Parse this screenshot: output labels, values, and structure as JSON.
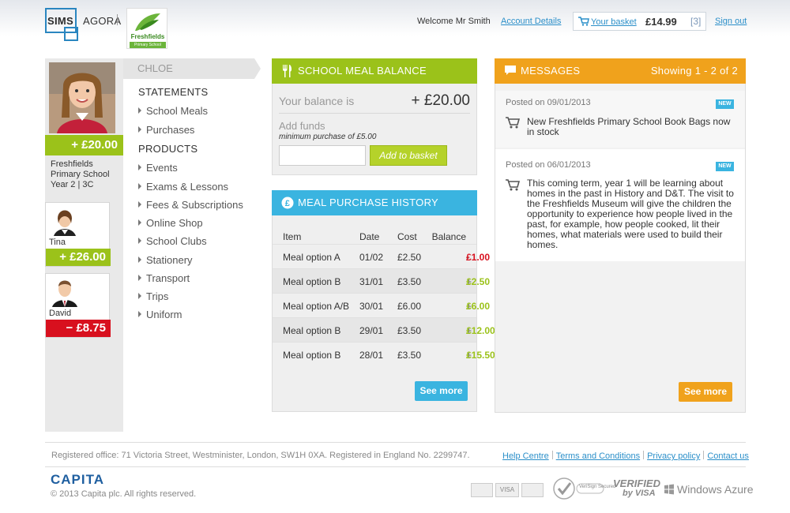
{
  "header": {
    "brand_left": "SIMS",
    "brand_right": "AGORA",
    "school_name": "Freshfields",
    "school_sub": "Primary School",
    "welcome": "Welcome Mr Smith",
    "account_link": "Account Details",
    "basket_label": "Your basket",
    "basket_amount": "£14.99",
    "basket_count": "[3]",
    "signout": "Sign out"
  },
  "profile": {
    "balance": "+ £20.00",
    "school_line1": "Freshfields",
    "school_line2": "Primary School",
    "class_line": "Year 2 | 3C",
    "siblings": [
      {
        "name": "Tina",
        "balance": "+ £26.00",
        "status": "positive"
      },
      {
        "name": "David",
        "balance": "− £8.75",
        "status": "negative"
      }
    ]
  },
  "nav": {
    "child": "CHLOE",
    "statements_heading": "STATEMENTS",
    "statements": [
      "School Meals",
      "Purchases"
    ],
    "products_heading": "PRODUCTS",
    "products": [
      "Events",
      "Exams & Lessons",
      "Fees & Subscriptions",
      "Online Shop",
      "School Clubs",
      "Stationery",
      "Transport",
      "Trips",
      "Uniform"
    ]
  },
  "meal_balance": {
    "title": "SCHOOL MEAL BALANCE",
    "balance_label": "Your balance is",
    "balance_value": "+ £20.00",
    "add_funds_label": "Add funds",
    "minimum_note": "minimum purchase of £5.00",
    "add_button": "Add to basket"
  },
  "history": {
    "title": "MEAL PURCHASE HISTORY",
    "columns": [
      "Item",
      "Date",
      "Cost",
      "Balance"
    ],
    "rows": [
      {
        "item": "Meal option A",
        "date": "01/02",
        "cost": "£2.50",
        "sign": "- ",
        "balance": "£1.00",
        "type": "neg"
      },
      {
        "item": "Meal option B",
        "date": "31/01",
        "cost": "£3.50",
        "sign": "+ ",
        "balance": "£2.50",
        "type": "pos"
      },
      {
        "item": "Meal option A/B",
        "date": "30/01",
        "cost": "£6.00",
        "sign": "+ ",
        "balance": "£6.00",
        "type": "pos"
      },
      {
        "item": "Meal option B",
        "date": "29/01",
        "cost": "£3.50",
        "sign": "+ ",
        "balance": "£12.00",
        "type": "pos"
      },
      {
        "item": "Meal option B",
        "date": "28/01",
        "cost": "£3.50",
        "sign": "+ ",
        "balance": "£15.50",
        "type": "pos"
      }
    ],
    "see_more": "See more"
  },
  "messages": {
    "title": "MESSAGES",
    "showing": "Showing 1 - 2 of 2",
    "items": [
      {
        "date": "Posted on 09/01/2013",
        "badge": "NEW",
        "text": "New Freshfields Primary School Book Bags now in stock"
      },
      {
        "date": "Posted on 06/01/2013",
        "badge": "NEW",
        "text": "This coming term, year 1 will be learning about homes in the past in History and D&T. The visit to the Freshfields Museum will give the children the opportunity to experience how people lived in the past, for example, how people cooked, lit their homes, what materials were used to build their homes."
      }
    ],
    "see_more": "See more"
  },
  "footer": {
    "registered": "Registered office: 71 Victoria Street, Westminister, London, SW1H 0XA. Registered in England No. 2299747.",
    "links": [
      "Help Centre",
      "Terms and Conditions",
      "Privacy policy",
      "Contact us"
    ],
    "company": "CAPITA",
    "copyright": "© 2013 Capita plc. All rights reserved.",
    "payment_visa": "VISA",
    "verisign": "VeriSign Secured",
    "verified_1": "VERIFIED",
    "verified_2": "by VISA",
    "azure": "Windows Azure"
  }
}
